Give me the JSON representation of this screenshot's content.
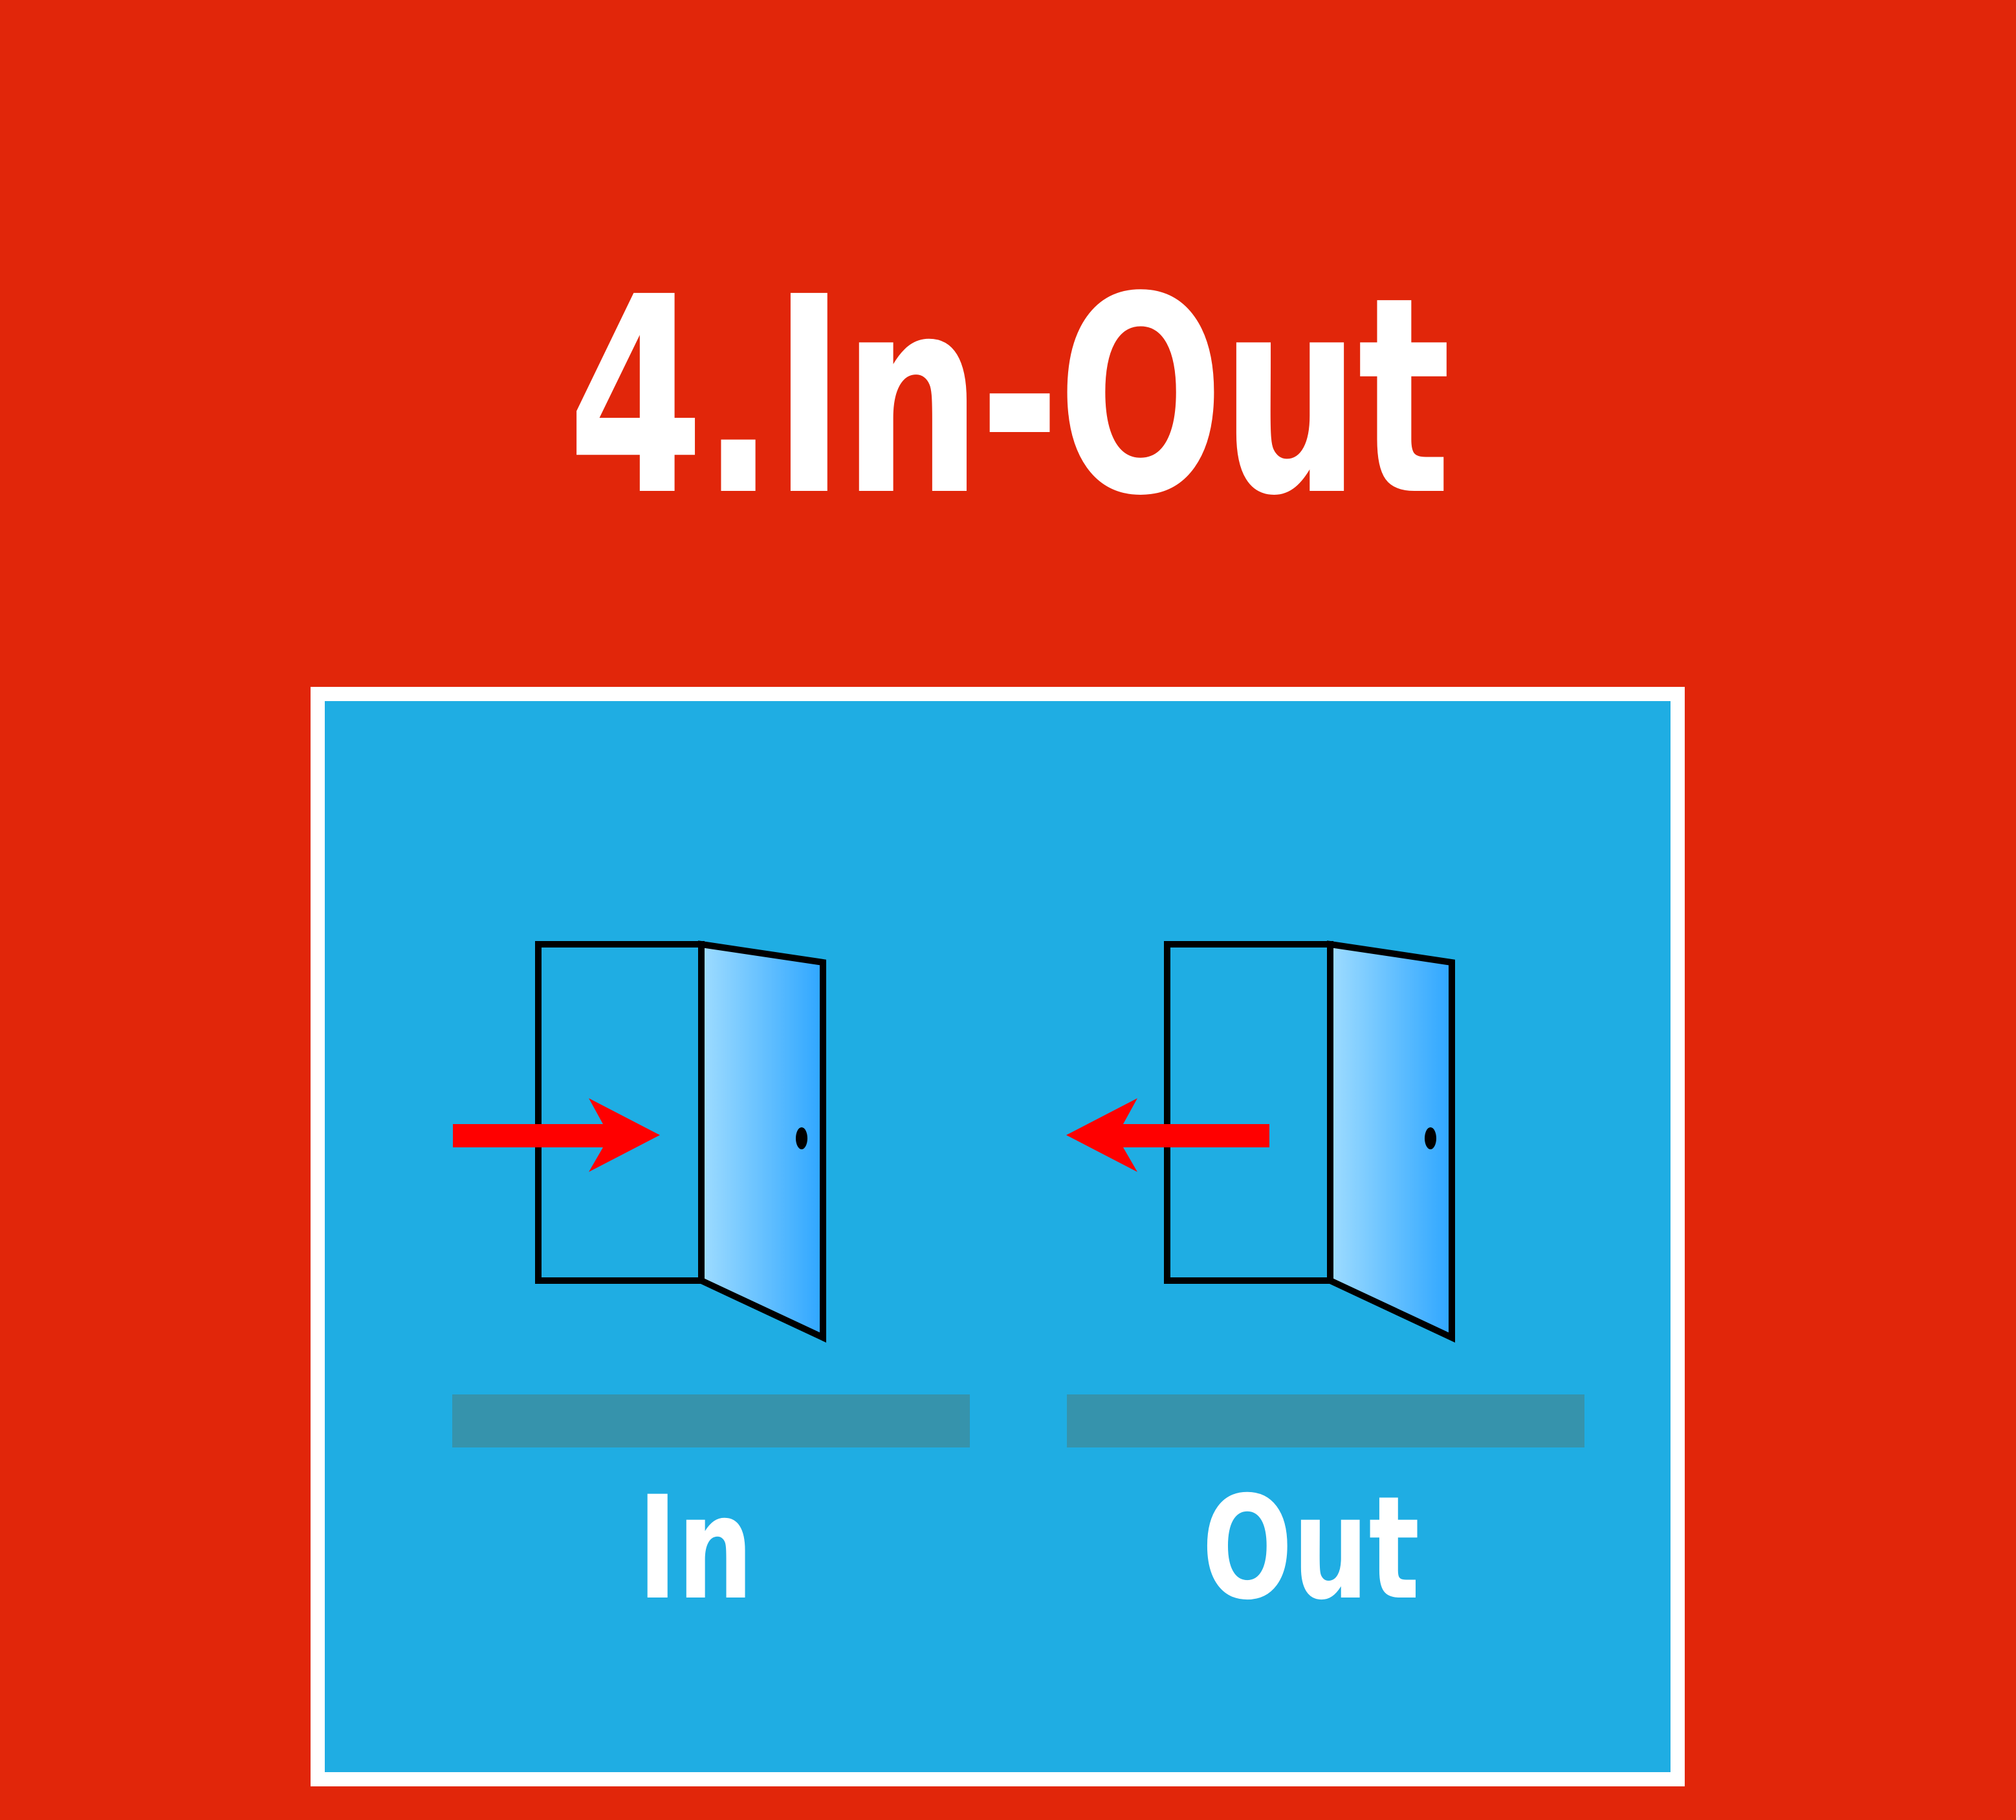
{
  "title": "4.In-Out",
  "panels": [
    {
      "label": "In",
      "arrow_direction": "into-door"
    },
    {
      "label": "Out",
      "arrow_direction": "out-of-door"
    }
  ],
  "colors": {
    "background": "#e1260a",
    "panel": "#1fade3",
    "panel_border": "#ffffff",
    "floor_bar": "#3693ac",
    "arrow": "#ff0000",
    "door_gradient_start": "#9fdcff",
    "door_gradient_end": "#2ea6ff",
    "outline": "#000000"
  },
  "icons": [
    "open-door-icon",
    "arrow-right-icon",
    "open-door-icon",
    "arrow-left-icon"
  ]
}
